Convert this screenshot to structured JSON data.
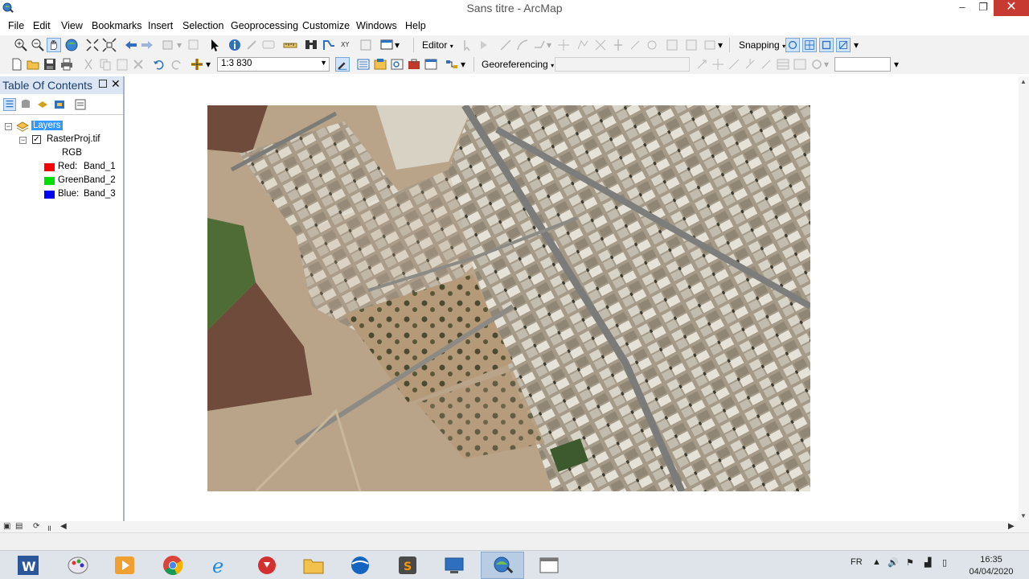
{
  "window": {
    "title": "Sans titre - ArcMap",
    "minimize": "–",
    "maximize": "❐",
    "close": "✕"
  },
  "menu": [
    "File",
    "Edit",
    "View",
    "Bookmarks",
    "Insert",
    "Selection",
    "Geoprocessing",
    "Customize",
    "Windows",
    "Help"
  ],
  "toolbar": {
    "editor_label": "Editor",
    "snapping_label": "Snapping",
    "scale_value": "1:3 830",
    "georeferencing_label": "Georeferencing"
  },
  "toc": {
    "title": "Table Of Contents",
    "data_frame": "Layers",
    "layer_name": "RasterProj.tif",
    "layer_checked": true,
    "composite": "RGB",
    "bands": [
      {
        "label": "Red:",
        "band": "Band_1",
        "color": "#ff0000"
      },
      {
        "label": "Green:",
        "band": "Band_2",
        "color": "#00dd00"
      },
      {
        "label": "Blue:",
        "band": "Band_3",
        "color": "#0000ff"
      }
    ]
  },
  "taskbar": {
    "apps": [
      "word-icon",
      "paint-icon",
      "media-player-icon",
      "chrome-icon",
      "ie-icon",
      "download-icon",
      "file-explorer-icon",
      "google-earth-icon",
      "sublime-icon",
      "network-icon",
      "arcmap-icon",
      "blank-window-icon"
    ],
    "language": "FR",
    "time": "16:35",
    "date": "04/04/2020"
  },
  "colors": {
    "accent_selection": "#3399ff",
    "close_button": "#c73a32",
    "toc_header": "#dbe5f3"
  }
}
